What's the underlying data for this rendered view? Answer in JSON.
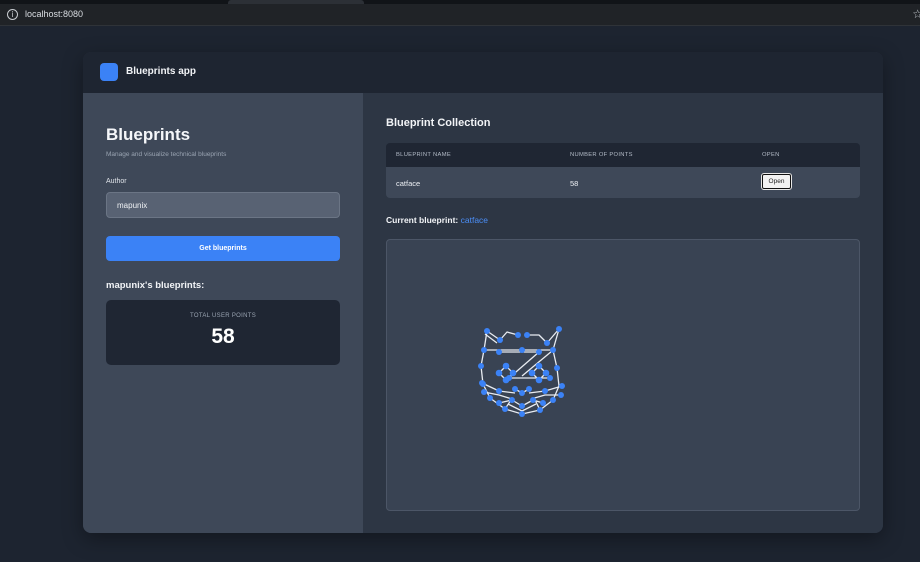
{
  "browser": {
    "url": "localhost:8080",
    "info_icon": "info-icon",
    "star_icon": "star-icon"
  },
  "app": {
    "title": "Blueprints app",
    "accent_color": "#3b82f6"
  },
  "sidebar": {
    "title": "Blueprints",
    "subtitle": "Manage and visualize technical blueprints",
    "author_label": "Author",
    "author_value": "mapunix",
    "get_button_label": "Get blueprints",
    "user_blueprints_title": "mapunix's blueprints:",
    "total_label": "TOTAL USER POINTS",
    "total_value": "58"
  },
  "main": {
    "collection_title": "Blueprint Collection",
    "columns": [
      "BLUEPRINT NAME",
      "NUMBER OF POINTS",
      "OPEN"
    ],
    "rows": [
      {
        "name": "catface",
        "points": "58",
        "action": "Open"
      }
    ],
    "current_label": "Current blueprint:",
    "current_name": "catface"
  }
}
